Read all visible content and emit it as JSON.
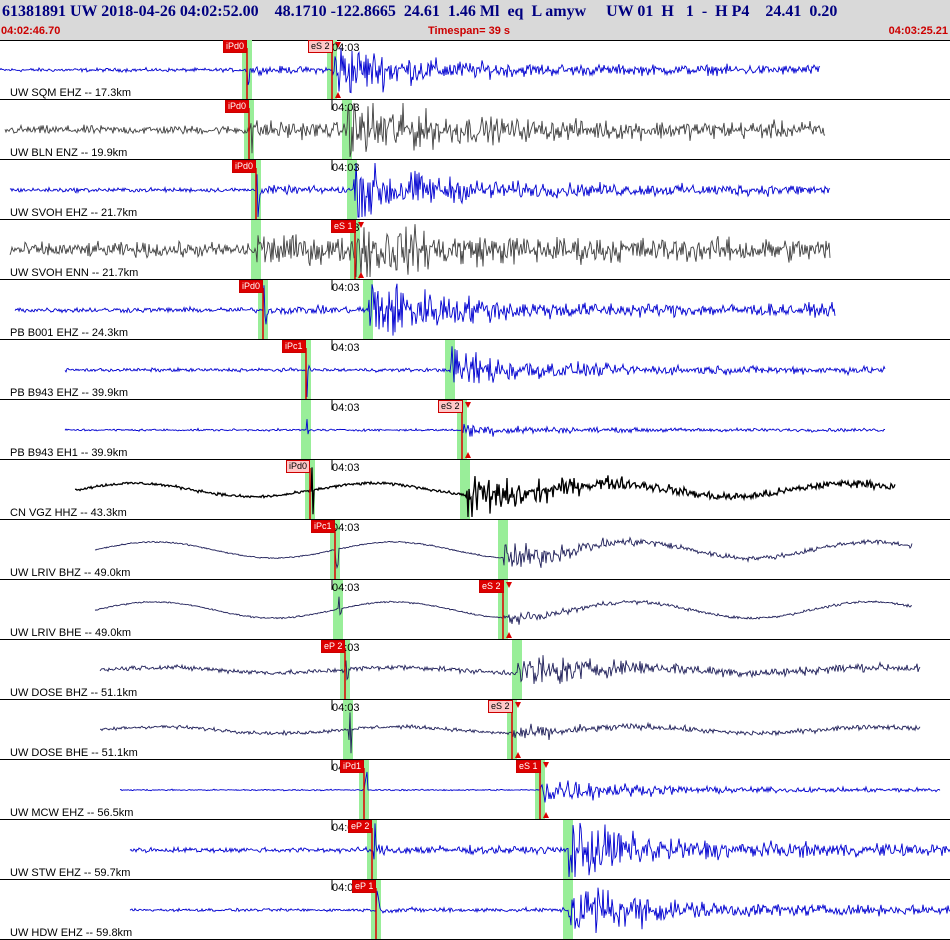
{
  "header": {
    "title": "61381891 UW 2018-04-26 04:02:52.00    48.1710 -122.8665  24.61  1.46 Ml  eq  L amyw     UW 01  H   1  -  H P4    24.41  0.20",
    "start_time": "04:02:46.70",
    "timespan": "Timespan=  39 s",
    "end_time": "04:03:25.21"
  },
  "colors": {
    "blue_trace": "#0000d0",
    "gray_trace": "#404040",
    "black_trace": "#000000",
    "navy_trace": "#20205a",
    "pick_line": "#dd0000",
    "window_band": "#99ee99"
  },
  "minute_marker": "04:03",
  "channels": [
    {
      "label": "UW SQM EHZ -- 17.3km",
      "color": "#0000d0",
      "p_pick": "iPd0",
      "s_pick": "eS 2",
      "s_style": "light",
      "start": 0,
      "end": 820,
      "p": 247,
      "s": 332,
      "pre": 0.05,
      "post": 0.45,
      "noise": 0.05,
      "wave": 0
    },
    {
      "label": "UW BLN ENZ -- 19.9km",
      "color": "#404040",
      "p_pick": "iPd0",
      "s_pick": "",
      "s_style": "",
      "start": 5,
      "end": 825,
      "p": 249,
      "s": 347,
      "pre": 0.12,
      "post": 0.5,
      "noise": 0.12,
      "wave": 0
    },
    {
      "label": "UW SVOH EHZ -- 21.7km",
      "color": "#0000d0",
      "p_pick": "iPd0",
      "s_pick": "",
      "s_style": "",
      "start": 10,
      "end": 830,
      "p": 256,
      "s": 352,
      "pre": 0.05,
      "post": 0.5,
      "noise": 0.06,
      "wave": 0
    },
    {
      "label": "UW SVOH ENN -- 21.7km",
      "color": "#404040",
      "p_pick": "",
      "s_pick": "eS 1",
      "s_style": "solid",
      "start": 10,
      "end": 830,
      "p": 256,
      "s": 355,
      "pre": 0.2,
      "post": 0.35,
      "noise": 0.2,
      "wave": 0
    },
    {
      "label": "PB B001 EHZ -- 24.3km",
      "color": "#0000d0",
      "p_pick": "iPd0",
      "s_pick": "",
      "s_style": "",
      "start": 15,
      "end": 835,
      "p": 263,
      "s": 368,
      "pre": 0.04,
      "post": 0.55,
      "noise": 0.07,
      "wave": 0
    },
    {
      "label": "PB B943 EHZ -- 39.9km",
      "color": "#0000d0",
      "p_pick": "iPc1",
      "s_pick": "",
      "s_style": "",
      "start": 65,
      "end": 885,
      "p": 306,
      "s": 450,
      "pre": 0.0,
      "post": 0.35,
      "noise": 0.05,
      "wave": 0
    },
    {
      "label": "PB B943 EH1 -- 39.9km",
      "color": "#0000d0",
      "p_pick": "",
      "s_pick": "eS 2",
      "s_style": "light",
      "start": 65,
      "end": 885,
      "p": 306,
      "s": 462,
      "pre": 0.0,
      "post": 0.1,
      "noise": 0.03,
      "wave": 0
    },
    {
      "label": "CN VGZ HHZ -- 43.3km",
      "color": "#000000",
      "p_pick": "iPd0",
      "s_pick": "",
      "s_style": "",
      "start": 75,
      "end": 895,
      "p": 310,
      "s": 465,
      "pre": 0.0,
      "post": 0.4,
      "noise": 0.04,
      "wave": 0.25
    },
    {
      "label": "UW LRIV BHZ -- 49.0km",
      "color": "#20205a",
      "p_pick": "iPc1",
      "s_pick": "",
      "s_style": "",
      "start": 95,
      "end": 912,
      "p": 335,
      "s": 503,
      "pre": 0.0,
      "post": 0.25,
      "noise": 0.02,
      "wave": 0.3
    },
    {
      "label": "UW LRIV BHE -- 49.0km",
      "color": "#20205a",
      "p_pick": "",
      "s_pick": "eS 2",
      "s_style": "solid",
      "start": 95,
      "end": 912,
      "p": 338,
      "s": 503,
      "pre": 0.0,
      "post": 0.08,
      "noise": 0.02,
      "wave": 0.3
    },
    {
      "label": "UW DOSE BHZ -- 51.1km",
      "color": "#20205a",
      "p_pick": "eP 2",
      "s_pick": "",
      "s_style": "",
      "start": 100,
      "end": 920,
      "p": 345,
      "s": 517,
      "pre": 0.0,
      "post": 0.3,
      "noise": 0.07,
      "wave": 0.1
    },
    {
      "label": "UW DOSE BHE -- 51.1km",
      "color": "#20205a",
      "p_pick": "",
      "s_pick": "eS 2",
      "s_style": "light",
      "start": 100,
      "end": 920,
      "p": 348,
      "s": 512,
      "pre": 0.0,
      "post": 0.1,
      "noise": 0.05,
      "wave": 0.12
    },
    {
      "label": "UW MCW EHZ -- 56.5km",
      "color": "#0000d0",
      "p_pick": "iPd1",
      "s_pick": "eS 1",
      "s_style": "solid",
      "start": 120,
      "end": 940,
      "p": 364,
      "s": 540,
      "pre": 0.0,
      "post": 0.25,
      "noise": 0.02,
      "wave": 0
    },
    {
      "label": "UW STW EHZ -- 59.7km",
      "color": "#0000d0",
      "p_pick": "eP 2",
      "s_pick": "",
      "s_style": "",
      "start": 130,
      "end": 950,
      "p": 372,
      "s": 568,
      "pre": 0.06,
      "post": 0.5,
      "noise": 0.07,
      "wave": 0
    },
    {
      "label": "UW HDW EHZ -- 59.8km",
      "color": "#0000d0",
      "p_pick": "eP 1",
      "s_pick": "",
      "s_style": "",
      "start": 130,
      "end": 950,
      "p": 376,
      "s": 568,
      "pre": 0.03,
      "post": 0.5,
      "noise": 0.04,
      "wave": 0
    }
  ]
}
